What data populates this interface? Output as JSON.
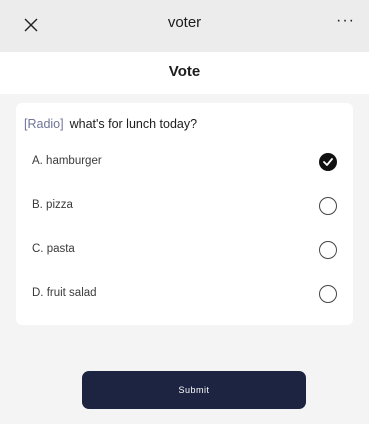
{
  "topbar": {
    "title": "voter",
    "close_icon": "close-icon",
    "more_label": "···"
  },
  "page": {
    "title": "Vote"
  },
  "question": {
    "type_tag": "[Radio]",
    "text": "what's for lunch today?"
  },
  "options": [
    {
      "label": "A. hamburger",
      "selected": true
    },
    {
      "label": "B. pizza",
      "selected": false
    },
    {
      "label": "C. pasta",
      "selected": false
    },
    {
      "label": "D. fruit salad",
      "selected": false
    }
  ],
  "submit": {
    "label": "Submit"
  },
  "colors": {
    "accent": "#1d2442",
    "tag": "#6f7597"
  }
}
